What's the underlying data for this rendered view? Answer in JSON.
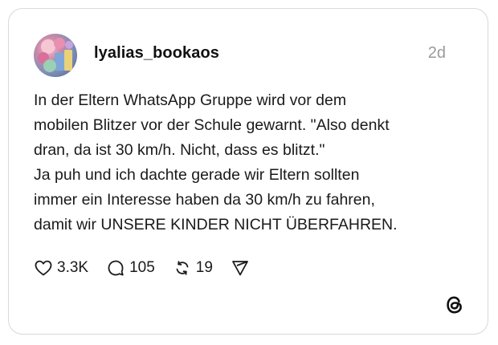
{
  "post": {
    "username": "lyalias_bookaos",
    "timestamp": "2d",
    "text_lines": [
      "In der Eltern WhatsApp Gruppe wird vor dem",
      "mobilen Blitzer vor der Schule gewarnt. \"Also denkt",
      "dran, da ist 30 km/h. Nicht, dass es blitzt.\"",
      "Ja puh und ich dachte gerade wir Eltern sollten",
      "immer ein Interesse haben da 30 km/h zu fahren,",
      "damit wir UNSERE KINDER NICHT ÜBERFAHREN."
    ]
  },
  "actions": {
    "likes": "3.3K",
    "replies": "105",
    "reposts": "19"
  },
  "icons": {
    "like": "heart-icon",
    "reply": "comment-bubble-icon",
    "repost": "repost-arrows-icon",
    "share": "send-icon",
    "brand": "threads-logo-icon"
  },
  "colors": {
    "text": "#1a1a1a",
    "muted": "#9a9a9a",
    "border": "#d9d9d9"
  }
}
